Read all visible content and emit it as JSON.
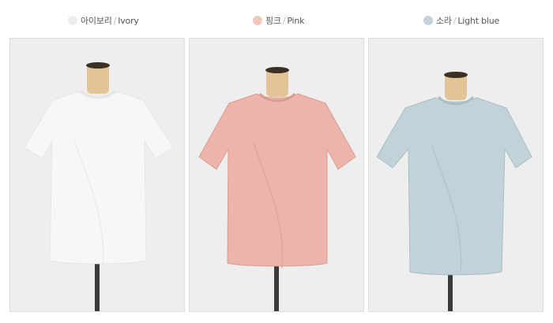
{
  "colors_section": {
    "options": [
      {
        "name_ko": "아이보리",
        "separator": "/",
        "name_en": "Ivory",
        "swatch_color": "#eeeeee",
        "shirt_color": "#f7f7f7",
        "shirt_shade": "#e6e6e6"
      },
      {
        "name_ko": "핑크",
        "separator": "/",
        "name_en": "Pink",
        "swatch_color": "#f2c7c0",
        "shirt_color": "#ecb4aa",
        "shirt_shade": "#d99c91"
      },
      {
        "name_ko": "소라",
        "separator": "/",
        "name_en": "Light blue",
        "swatch_color": "#c3d3d7",
        "shirt_color": "#c1d3d8",
        "shirt_shade": "#a9bdc3"
      }
    ]
  },
  "photo_background": "#eeeeee",
  "mannequin_neck_color": "#e2c496",
  "stand_pole_color": "#3b3b3b"
}
